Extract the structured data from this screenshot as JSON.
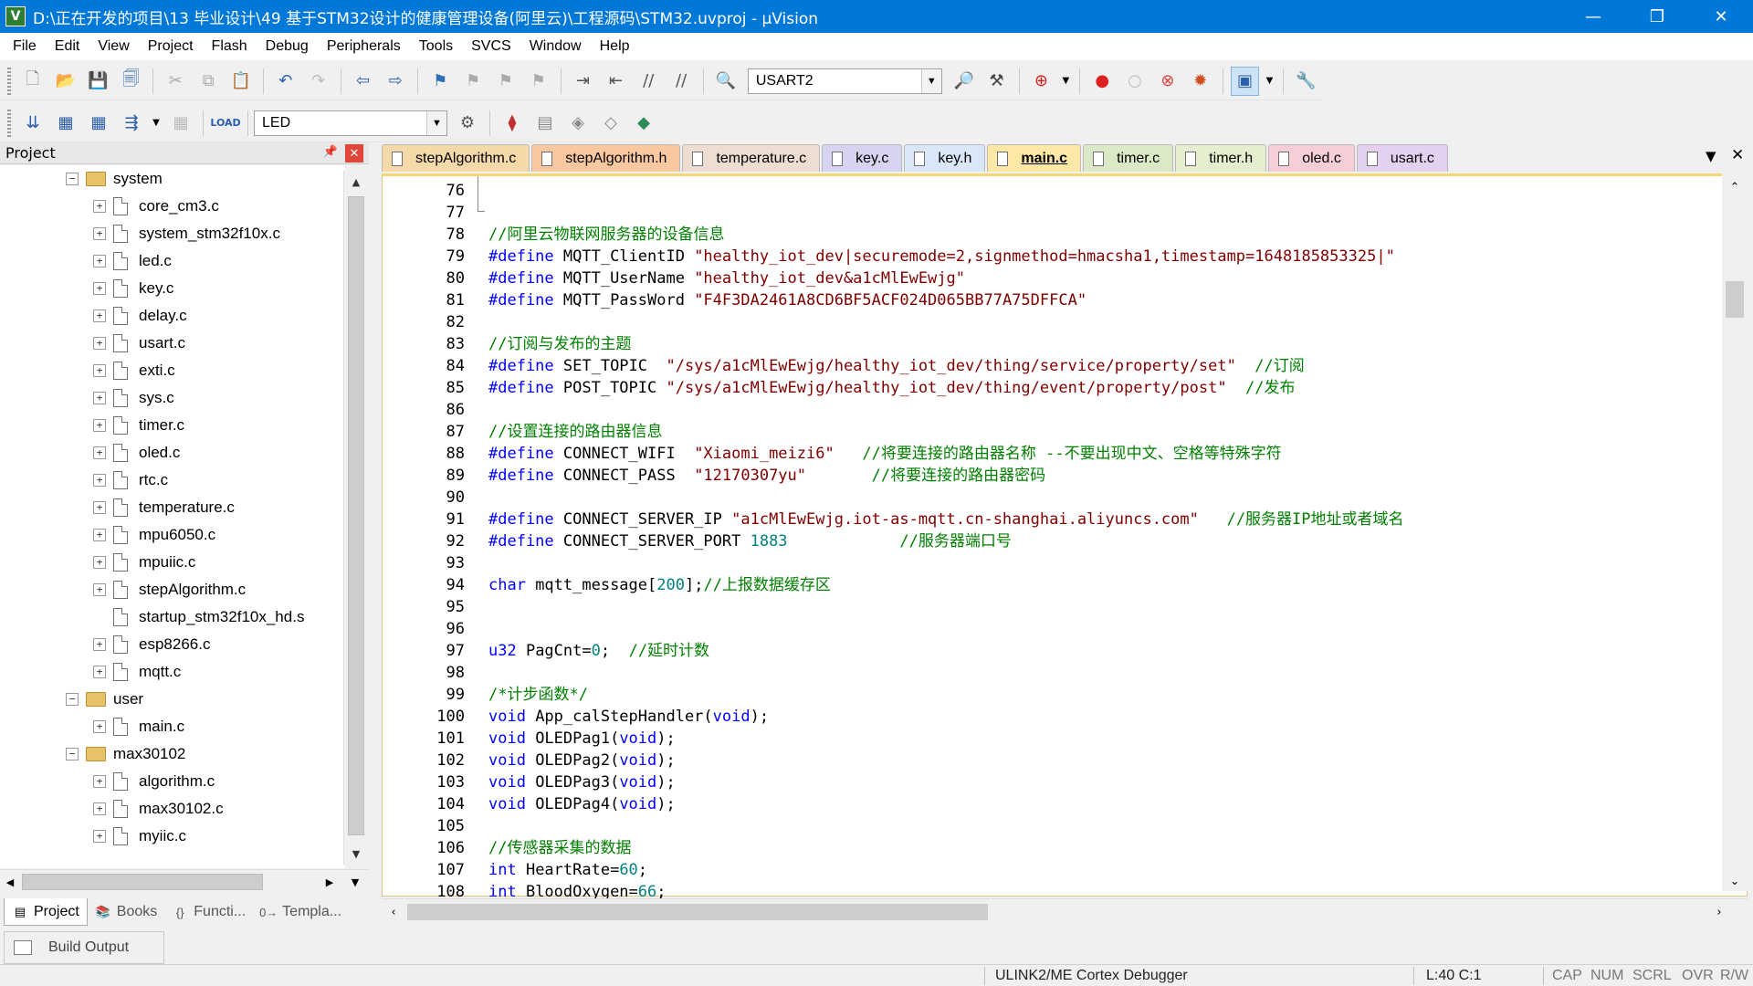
{
  "window": {
    "title": "D:\\正在开发的项目\\13 毕业设计\\49 基于STM32设计的健康管理设备(阿里云)\\工程源码\\STM32.uvproj - µVision",
    "app_icon": "uvision-icon",
    "minimize": "—",
    "restore": "❐",
    "close": "✕"
  },
  "menu": [
    "File",
    "Edit",
    "View",
    "Project",
    "Flash",
    "Debug",
    "Peripherals",
    "Tools",
    "SVCS",
    "Window",
    "Help"
  ],
  "toolbar1": {
    "find_combo": "USART2"
  },
  "toolbar2": {
    "target_combo": "LED"
  },
  "project_panel": {
    "title": "Project",
    "pin": "📌",
    "close": "✕",
    "tree": [
      {
        "type": "folder",
        "label": "system",
        "expanded": true,
        "level": 0
      },
      {
        "type": "file",
        "label": "core_cm3.c",
        "level": 1,
        "expandable": true
      },
      {
        "type": "file",
        "label": "system_stm32f10x.c",
        "level": 1,
        "expandable": true
      },
      {
        "type": "file",
        "label": "led.c",
        "level": 1,
        "expandable": true
      },
      {
        "type": "file",
        "label": "key.c",
        "level": 1,
        "expandable": true
      },
      {
        "type": "file",
        "label": "delay.c",
        "level": 1,
        "expandable": true
      },
      {
        "type": "file",
        "label": "usart.c",
        "level": 1,
        "expandable": true
      },
      {
        "type": "file",
        "label": "exti.c",
        "level": 1,
        "expandable": true
      },
      {
        "type": "file",
        "label": "sys.c",
        "level": 1,
        "expandable": true
      },
      {
        "type": "file",
        "label": "timer.c",
        "level": 1,
        "expandable": true
      },
      {
        "type": "file",
        "label": "oled.c",
        "level": 1,
        "expandable": true
      },
      {
        "type": "file",
        "label": "rtc.c",
        "level": 1,
        "expandable": true
      },
      {
        "type": "file",
        "label": "temperature.c",
        "level": 1,
        "expandable": true
      },
      {
        "type": "file",
        "label": "mpu6050.c",
        "level": 1,
        "expandable": true
      },
      {
        "type": "file",
        "label": "mpuiic.c",
        "level": 1,
        "expandable": true
      },
      {
        "type": "file",
        "label": "stepAlgorithm.c",
        "level": 1,
        "expandable": true
      },
      {
        "type": "file",
        "label": "startup_stm32f10x_hd.s",
        "level": 1,
        "expandable": false
      },
      {
        "type": "file",
        "label": "esp8266.c",
        "level": 1,
        "expandable": true
      },
      {
        "type": "file",
        "label": "mqtt.c",
        "level": 1,
        "expandable": true
      },
      {
        "type": "folder",
        "label": "user",
        "expanded": true,
        "level": 0
      },
      {
        "type": "file",
        "label": "main.c",
        "level": 1,
        "expandable": true
      },
      {
        "type": "folder",
        "label": "max30102",
        "expanded": true,
        "level": 0
      },
      {
        "type": "file",
        "label": "algorithm.c",
        "level": 1,
        "expandable": true
      },
      {
        "type": "file",
        "label": "max30102.c",
        "level": 1,
        "expandable": true
      },
      {
        "type": "file",
        "label": "myiic.c",
        "level": 1,
        "expandable": true
      }
    ]
  },
  "left_tabs": [
    {
      "label": "Project",
      "icon": "project-icon",
      "glyph": "▤",
      "active": true
    },
    {
      "label": "Books",
      "icon": "books-icon",
      "glyph": "📚",
      "active": false
    },
    {
      "label": "Functi...",
      "icon": "functions-icon",
      "glyph": "{}",
      "active": false
    },
    {
      "label": "Templa...",
      "icon": "templates-icon",
      "glyph": "0→",
      "active": false
    }
  ],
  "editor_tabs": [
    {
      "label": "stepAlgorithm.c",
      "color": "#f5d9a8",
      "active": false
    },
    {
      "label": "stepAlgorithm.h",
      "color": "#f9c8a0",
      "active": false
    },
    {
      "label": "temperature.c",
      "color": "#eeded2",
      "active": false
    },
    {
      "label": "key.c",
      "color": "#d6d4f0",
      "active": false
    },
    {
      "label": "key.h",
      "color": "#d9e7f7",
      "active": false
    },
    {
      "label": "main.c",
      "color": "#fde9a5",
      "active": true
    },
    {
      "label": "timer.c",
      "color": "#dbe9c7",
      "active": false
    },
    {
      "label": "timer.h",
      "color": "#e5efcf",
      "active": false
    },
    {
      "label": "oled.c",
      "color": "#f6cfd6",
      "active": false
    },
    {
      "label": "usart.c",
      "color": "#e4d1ef",
      "active": false
    }
  ],
  "code": [
    {
      "n": "76",
      "parts": []
    },
    {
      "n": "77",
      "parts": []
    },
    {
      "n": "78",
      "parts": [
        {
          "c": "t-comment",
          "t": "//阿里云物联网服务器的设备信息"
        }
      ]
    },
    {
      "n": "79",
      "parts": [
        {
          "c": "t-pre",
          "t": "#define"
        },
        {
          "c": "t-plain",
          "t": " MQTT_ClientID "
        },
        {
          "c": "t-str",
          "t": "\"healthy_iot_dev|securemode=2,signmethod=hmacsha1,timestamp=1648185853325|\""
        }
      ]
    },
    {
      "n": "80",
      "parts": [
        {
          "c": "t-pre",
          "t": "#define"
        },
        {
          "c": "t-plain",
          "t": " MQTT_UserName "
        },
        {
          "c": "t-str",
          "t": "\"healthy_iot_dev&a1cMlEwEwjg\""
        }
      ]
    },
    {
      "n": "81",
      "parts": [
        {
          "c": "t-pre",
          "t": "#define"
        },
        {
          "c": "t-plain",
          "t": " MQTT_PassWord "
        },
        {
          "c": "t-str",
          "t": "\"F4F3DA2461A8CD6BF5ACF024D065BB77A75DFFCA\""
        }
      ]
    },
    {
      "n": "82",
      "parts": []
    },
    {
      "n": "83",
      "parts": [
        {
          "c": "t-comment",
          "t": "//订阅与发布的主题"
        }
      ]
    },
    {
      "n": "84",
      "parts": [
        {
          "c": "t-pre",
          "t": "#define"
        },
        {
          "c": "t-plain",
          "t": " SET_TOPIC  "
        },
        {
          "c": "t-str",
          "t": "\"/sys/a1cMlEwEwjg/healthy_iot_dev/thing/service/property/set\""
        },
        {
          "c": "t-comment",
          "t": "  //订阅"
        }
      ]
    },
    {
      "n": "85",
      "parts": [
        {
          "c": "t-pre",
          "t": "#define"
        },
        {
          "c": "t-plain",
          "t": " POST_TOPIC "
        },
        {
          "c": "t-str",
          "t": "\"/sys/a1cMlEwEwjg/healthy_iot_dev/thing/event/property/post\""
        },
        {
          "c": "t-comment",
          "t": "  //发布"
        }
      ]
    },
    {
      "n": "86",
      "parts": []
    },
    {
      "n": "87",
      "parts": [
        {
          "c": "t-comment",
          "t": "//设置连接的路由器信息"
        }
      ]
    },
    {
      "n": "88",
      "parts": [
        {
          "c": "t-pre",
          "t": "#define"
        },
        {
          "c": "t-plain",
          "t": " CONNECT_WIFI  "
        },
        {
          "c": "t-str",
          "t": "\"Xiaomi_meizi6\""
        },
        {
          "c": "t-comment",
          "t": "   //将要连接的路由器名称 --不要出现中文、空格等特殊字符"
        }
      ]
    },
    {
      "n": "89",
      "parts": [
        {
          "c": "t-pre",
          "t": "#define"
        },
        {
          "c": "t-plain",
          "t": " CONNECT_PASS  "
        },
        {
          "c": "t-str",
          "t": "\"12170307yu\""
        },
        {
          "c": "t-comment",
          "t": "       //将要连接的路由器密码"
        }
      ]
    },
    {
      "n": "90",
      "parts": []
    },
    {
      "n": "91",
      "parts": [
        {
          "c": "t-pre",
          "t": "#define"
        },
        {
          "c": "t-plain",
          "t": " CONNECT_SERVER_IP "
        },
        {
          "c": "t-str",
          "t": "\"a1cMlEwEwjg.iot-as-mqtt.cn-shanghai.aliyuncs.com\""
        },
        {
          "c": "t-comment",
          "t": "   //服务器IP地址或者域名"
        }
      ]
    },
    {
      "n": "92",
      "parts": [
        {
          "c": "t-pre",
          "t": "#define"
        },
        {
          "c": "t-plain",
          "t": " CONNECT_SERVER_PORT "
        },
        {
          "c": "t-num",
          "t": "1883"
        },
        {
          "c": "t-comment",
          "t": "            //服务器端口号"
        }
      ]
    },
    {
      "n": "93",
      "parts": []
    },
    {
      "n": "94",
      "parts": [
        {
          "c": "t-kw",
          "t": "char"
        },
        {
          "c": "t-plain",
          "t": " mqtt_message["
        },
        {
          "c": "t-num",
          "t": "200"
        },
        {
          "c": "t-plain",
          "t": "];"
        },
        {
          "c": "t-comment",
          "t": "//上报数据缓存区"
        }
      ]
    },
    {
      "n": "95",
      "parts": []
    },
    {
      "n": "96",
      "parts": []
    },
    {
      "n": "97",
      "parts": [
        {
          "c": "t-kw",
          "t": "u32"
        },
        {
          "c": "t-plain",
          "t": " PagCnt="
        },
        {
          "c": "t-num",
          "t": "0"
        },
        {
          "c": "t-plain",
          "t": ";  "
        },
        {
          "c": "t-comment",
          "t": "//延时计数"
        }
      ]
    },
    {
      "n": "98",
      "parts": []
    },
    {
      "n": "99",
      "parts": [
        {
          "c": "t-comment",
          "t": "/*计步函数*/"
        }
      ]
    },
    {
      "n": "100",
      "parts": [
        {
          "c": "t-kw",
          "t": "void"
        },
        {
          "c": "t-plain",
          "t": " App_calStepHandler("
        },
        {
          "c": "t-kw",
          "t": "void"
        },
        {
          "c": "t-plain",
          "t": ");"
        }
      ]
    },
    {
      "n": "101",
      "parts": [
        {
          "c": "t-kw",
          "t": "void"
        },
        {
          "c": "t-plain",
          "t": " OLEDPag1("
        },
        {
          "c": "t-kw",
          "t": "void"
        },
        {
          "c": "t-plain",
          "t": ");"
        }
      ]
    },
    {
      "n": "102",
      "parts": [
        {
          "c": "t-kw",
          "t": "void"
        },
        {
          "c": "t-plain",
          "t": " OLEDPag2("
        },
        {
          "c": "t-kw",
          "t": "void"
        },
        {
          "c": "t-plain",
          "t": ");"
        }
      ]
    },
    {
      "n": "103",
      "parts": [
        {
          "c": "t-kw",
          "t": "void"
        },
        {
          "c": "t-plain",
          "t": " OLEDPag3("
        },
        {
          "c": "t-kw",
          "t": "void"
        },
        {
          "c": "t-plain",
          "t": ");"
        }
      ]
    },
    {
      "n": "104",
      "parts": [
        {
          "c": "t-kw",
          "t": "void"
        },
        {
          "c": "t-plain",
          "t": " OLEDPag4("
        },
        {
          "c": "t-kw",
          "t": "void"
        },
        {
          "c": "t-plain",
          "t": ");"
        }
      ]
    },
    {
      "n": "105",
      "parts": []
    },
    {
      "n": "106",
      "parts": [
        {
          "c": "t-comment",
          "t": "//传感器采集的数据"
        }
      ]
    },
    {
      "n": "107",
      "parts": [
        {
          "c": "t-kw",
          "t": "int"
        },
        {
          "c": "t-plain",
          "t": " HeartRate="
        },
        {
          "c": "t-num",
          "t": "60"
        },
        {
          "c": "t-plain",
          "t": ";"
        }
      ]
    },
    {
      "n": "108",
      "parts": [
        {
          "c": "t-kw",
          "t": "int"
        },
        {
          "c": "t-plain",
          "t": " BloodOxygen="
        },
        {
          "c": "t-num",
          "t": "66"
        },
        {
          "c": "t-plain",
          "t": ";"
        }
      ]
    }
  ],
  "build_output": {
    "label": "Build Output"
  },
  "status": {
    "debugger": "ULINK2/ME Cortex Debugger",
    "cursor": "L:40 C:1",
    "cap": "CAP",
    "num": "NUM",
    "scrl": "SCRL",
    "ovr": "OVR",
    "rw": "R/W"
  }
}
